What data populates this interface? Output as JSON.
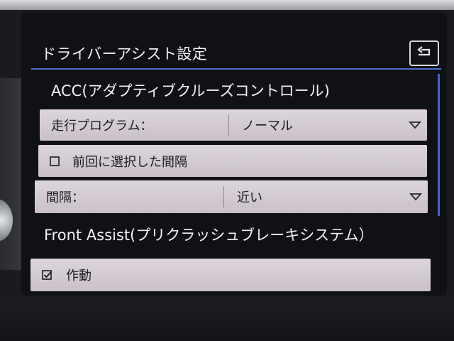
{
  "screen": {
    "title": "ドライバーアシスト設定"
  },
  "acc": {
    "header": "ACC(アダプティブクルーズコントロール)",
    "program": {
      "label": "走行プログラム：",
      "value": "ノーマル"
    },
    "previous_interval": {
      "label": "前回に選択した間隔",
      "checked": false
    },
    "interval": {
      "label": "間隔：",
      "value": "近い"
    }
  },
  "front_assist": {
    "header": "Front Assist(プリクラッシュブレーキシステム）",
    "active": {
      "label": "作動",
      "checked": true
    }
  },
  "icons": {
    "back": "back-arrow-icon",
    "dropdown": "chevron-down-icon",
    "checkbox_off": "checkbox-unchecked-icon",
    "checkbox_on": "checkbox-checked-icon"
  },
  "colors": {
    "accent": "#4d6ec8",
    "row_bg": "#d5ccd5",
    "text_light": "#f1f2f5",
    "text_dark": "#1b1b1f"
  }
}
